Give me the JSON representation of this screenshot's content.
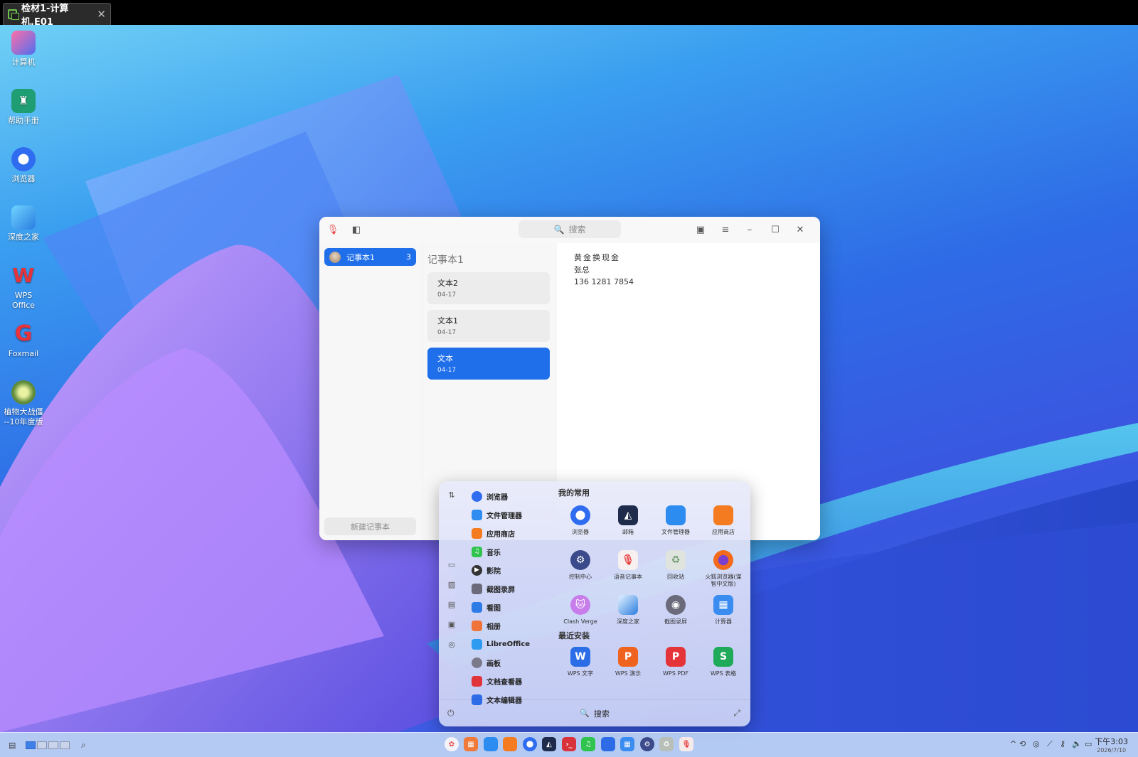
{
  "vm": {
    "tab_title": "检材1-计算机.E01",
    "close": "✕"
  },
  "desktop": {
    "icons": [
      {
        "label": "计算机",
        "icon": "computer-icon"
      },
      {
        "label": "帮助手册",
        "icon": "help-manual-icon"
      },
      {
        "label": "浏览器",
        "icon": "browser-icon"
      },
      {
        "label": "深度之家",
        "icon": "deepin-home-icon"
      },
      {
        "label": "WPS Office",
        "icon": "wps-office-icon"
      },
      {
        "label": "Foxmail",
        "icon": "foxmail-icon"
      },
      {
        "label": "植物大战僵尸\n10年度版",
        "line1": "植物大战僵",
        "line2": "--10年度版",
        "icon": "plants-vs-zombies-icon"
      }
    ]
  },
  "notes_window": {
    "search_placeholder": "搜索",
    "notebook": {
      "name": "记事本1",
      "count": "3"
    },
    "new_notebook": "新建记事本",
    "list_title": "记事本1",
    "notes": [
      {
        "title": "文本2",
        "date": "04-17",
        "selected": false
      },
      {
        "title": "文本1",
        "date": "04-17",
        "selected": false
      },
      {
        "title": "文本",
        "date": "04-17",
        "selected": true
      }
    ],
    "content": [
      "黄金换现金",
      "张总",
      "136 1281 7854"
    ]
  },
  "launcher": {
    "apps": [
      {
        "name": "浏览器",
        "icon": "browser-icon",
        "color": "#2f6cf0"
      },
      {
        "name": "文件管理器",
        "icon": "file-manager-icon",
        "color": "#2d8cf0"
      },
      {
        "name": "应用商店",
        "icon": "app-store-icon",
        "color": "#f47b20"
      },
      {
        "name": "音乐",
        "icon": "music-icon",
        "color": "#30c34e"
      },
      {
        "name": "影院",
        "icon": "movie-icon",
        "color": "#333333"
      },
      {
        "name": "截图录屏",
        "icon": "screenshot-icon",
        "color": "#6a6a7a"
      },
      {
        "name": "看图",
        "icon": "image-viewer-icon",
        "color": "#2d7be6"
      },
      {
        "name": "相册",
        "icon": "album-icon",
        "color": "#f0743a"
      },
      {
        "name": "LibreOffice",
        "icon": "libreoffice-icon",
        "color": "#2d9cf0"
      },
      {
        "name": "画板",
        "icon": "draw-icon",
        "color": "#7a7a8a"
      },
      {
        "name": "文档查看器",
        "icon": "document-viewer-icon",
        "color": "#e0333a"
      },
      {
        "name": "文本编辑器",
        "icon": "text-editor-icon",
        "color": "#2d6ce6"
      }
    ],
    "favorites_title": "我的常用",
    "favorites": [
      {
        "name": "浏览器",
        "icon": "browser-icon",
        "color": "#2f6cf0"
      },
      {
        "name": "邮箱",
        "icon": "mail-icon",
        "color": "#1e2b4a"
      },
      {
        "name": "文件管理器",
        "icon": "file-manager-icon",
        "color": "#2d8cf0"
      },
      {
        "name": "应用商店",
        "icon": "app-store-icon",
        "color": "#f47b20"
      },
      {
        "name": "控制中心",
        "icon": "control-center-icon",
        "color": "#3b4a8a"
      },
      {
        "name": "语音记事本",
        "icon": "voice-notes-icon",
        "color": "#e84a4a"
      },
      {
        "name": "回收站",
        "icon": "trash-icon",
        "color": "#9aa39a"
      },
      {
        "name": "火狐浏览器(谋智中文版)",
        "line1": "火狐浏览器(谋",
        "line2": "智中文版)",
        "icon": "firefox-icon",
        "color": "#f26b1d"
      },
      {
        "name": "Clash Verge",
        "icon": "clash-verge-icon",
        "color": "#c77dea"
      },
      {
        "name": "深度之家",
        "icon": "deepin-home-icon",
        "color": "#2a7de0"
      },
      {
        "name": "截图录屏",
        "icon": "screenshot-icon",
        "color": "#6a6a7a"
      },
      {
        "name": "计算器",
        "icon": "calculator-icon",
        "color": "#3a8cf0"
      }
    ],
    "recent_title": "最近安装",
    "recent": [
      {
        "name": "WPS 文字",
        "glyph": "W",
        "icon": "wps-writer-icon",
        "color": "#2b6de6"
      },
      {
        "name": "WPS 演示",
        "glyph": "P",
        "icon": "wps-presentation-icon",
        "color": "#f0631e"
      },
      {
        "name": "WPS PDF",
        "glyph": "P",
        "icon": "wps-pdf-icon",
        "color": "#e5333a"
      },
      {
        "name": "WPS 表格",
        "glyph": "S",
        "icon": "wps-spreadsheet-icon",
        "color": "#1faa5a"
      }
    ],
    "search_label": "搜索"
  },
  "taskbar": {
    "dock": [
      {
        "icon": "launcher-icon",
        "color": "#f4f4f8"
      },
      {
        "icon": "multitask-icon",
        "color": "#f07a3a"
      },
      {
        "icon": "file-manager-icon",
        "color": "#2d8cf0"
      },
      {
        "icon": "app-store-icon",
        "color": "#f47b20"
      },
      {
        "icon": "browser-icon",
        "color": "#2f6cf0"
      },
      {
        "icon": "mail-icon",
        "color": "#1e2b4a"
      },
      {
        "icon": "terminal-icon",
        "color": "#d8333a"
      },
      {
        "icon": "music-icon",
        "color": "#30c34e"
      },
      {
        "icon": "document-icon",
        "color": "#2d6ce6"
      },
      {
        "icon": "calculator-icon",
        "color": "#3a8cf0"
      },
      {
        "icon": "control-center-icon",
        "color": "#3b4a8a"
      },
      {
        "icon": "trash-icon",
        "color": "#b8bfb8"
      },
      {
        "icon": "voice-notes-icon",
        "color": "#e84a4a"
      }
    ],
    "time": "下午3:03",
    "date": "2026/7/10"
  }
}
